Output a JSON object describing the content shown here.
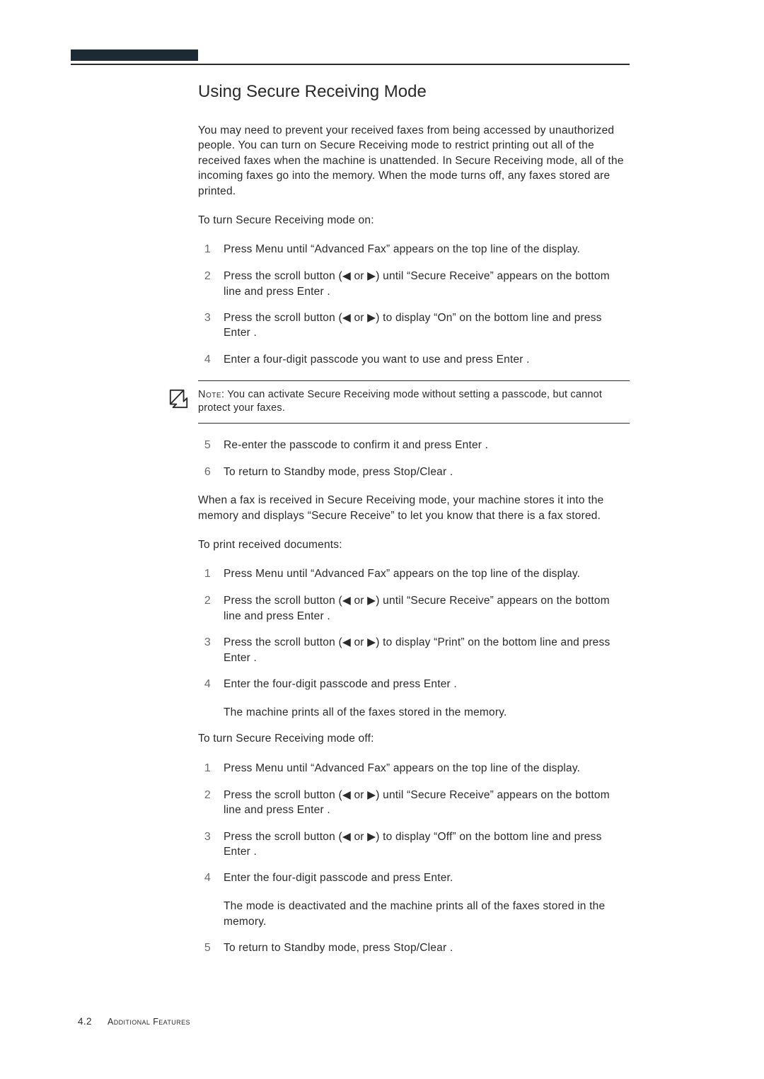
{
  "page": {
    "number": "4.2",
    "chapter_footer": "Additional Features"
  },
  "section": {
    "title": "Using Secure Receiving Mode"
  },
  "intro": "You may need to prevent your received faxes from being accessed by unauthorized people. You can turn on Secure Receiving mode to restrict printing out all of the received faxes when the machine is unattended. In Secure Receiving mode, all of the incoming faxes go into the memory. When the mode turns off, any faxes stored are printed.",
  "procA": {
    "lead": "To turn Secure Receiving mode on:",
    "steps": [
      "Press Menu  until “Advanced Fax” appears on the top line of the display.",
      "Press the scroll button (◀ or ▶) until “Secure Receive” appears on the bottom line and press Enter .",
      "Press the scroll button (◀ or ▶) to display “On” on the bottom line and press Enter .",
      "Enter a four-digit passcode you want to use and press Enter ."
    ]
  },
  "note": {
    "label": "Note",
    "text": ": You can activate Secure Receiving mode without setting a passcode, but cannot protect your faxes."
  },
  "procA2": {
    "start": 5,
    "steps": [
      "Re-enter the passcode to confirm it and press Enter .",
      "To return to Standby mode, press Stop/Clear  ."
    ]
  },
  "mid_text": "When a fax is received in Secure Receiving mode, your machine stores it into the memory and displays “Secure Receive” to let you know that there is a fax stored.",
  "procB": {
    "lead": "To print received documents:",
    "steps": [
      "Press Menu  until “Advanced Fax” appears on the top line of the display.",
      "Press the scroll button (◀ or ▶) until “Secure Receive” appears on the bottom line and press Enter .",
      "Press the scroll button (◀ or ▶) to display “Print” on the bottom line and press Enter .",
      "Enter the four-digit passcode and press Enter ."
    ],
    "tail": "The machine prints all of the faxes stored in the memory."
  },
  "procC": {
    "lead": "To turn Secure Receiving mode off:",
    "steps": [
      "Press Menu  until “Advanced Fax” appears on the top line of the display.",
      "Press the scroll button (◀ or ▶) until “Secure Receive” appears on the bottom line and press Enter .",
      "Press the scroll button (◀ or ▶) to display “Off” on the bottom line and press Enter .",
      "Enter the four-digit passcode and press Enter."
    ],
    "tail": "The mode is deactivated and the machine prints all of the faxes stored in the memory.",
    "step5": "To return to Standby mode, press Stop/Clear  ."
  }
}
